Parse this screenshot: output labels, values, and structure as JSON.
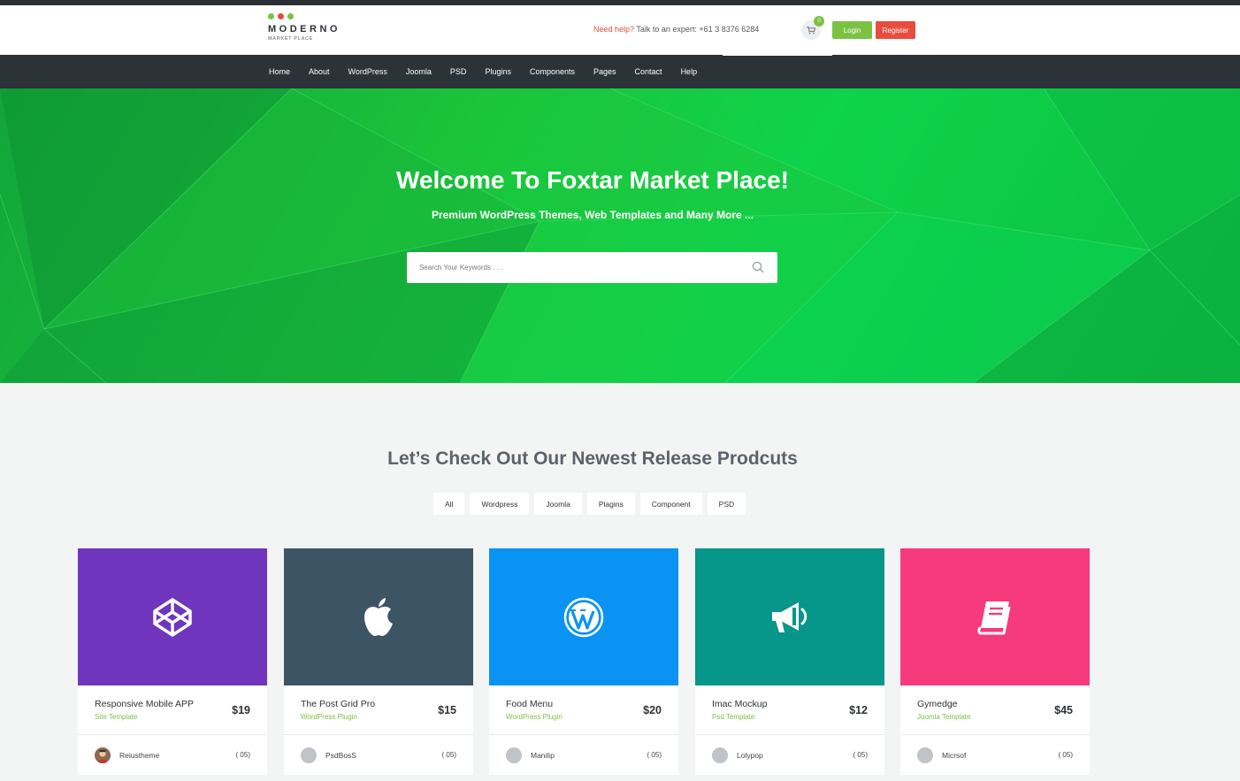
{
  "header": {
    "logo_name": "MODERNO",
    "logo_sub": "MARKET PLACE",
    "logo_dot_colors": [
      "#7cc142",
      "#e74c3c",
      "#7cc142"
    ],
    "help_prefix": "Need help?",
    "help_text": " Talk to an expert: +61 3 8376 6284",
    "cart_icon": "shopping-cart-icon",
    "cart_count": "0",
    "login_label": "Login",
    "register_label": "Register"
  },
  "nav": {
    "items": [
      {
        "label": "Home"
      },
      {
        "label": "About"
      },
      {
        "label": "WordPress"
      },
      {
        "label": "Joomla"
      },
      {
        "label": "PSD"
      },
      {
        "label": "Plugins"
      },
      {
        "label": "Components"
      },
      {
        "label": "Pages"
      },
      {
        "label": "Contact"
      },
      {
        "label": "Help"
      }
    ]
  },
  "hero": {
    "title": "Welcome To Foxtar Market Place!",
    "subtitle": "Premium WordPress Themes, Web Templates and Many More ...",
    "search_placeholder": "Search Your Keywords . . .",
    "search_icon": "search-icon"
  },
  "products": {
    "section_title": "Let’s Check Out Our Newest Release Prodcuts",
    "filters": [
      "All",
      "Wordpress",
      "Joomla",
      "Plagins",
      "Component",
      "PSD"
    ],
    "items": [
      {
        "name": "Responsive Mobile APP",
        "category": "Site Template",
        "price": "$19",
        "author": "Reiustheme",
        "count": "( 05)",
        "icon": "codepen-cube-icon",
        "color": "#6f36bd"
      },
      {
        "name": "The Post Grid Pro",
        "category": "WordPress Plugin",
        "price": "$15",
        "author": "PsdBosS",
        "count": "( 05)",
        "icon": "apple-icon",
        "color": "#3d5464"
      },
      {
        "name": "Food Menu",
        "category": "WordPress Plugin",
        "price": "$20",
        "author": "Manilip",
        "count": "( 05)",
        "icon": "wordpress-icon",
        "color": "#0a93f2"
      },
      {
        "name": "Imac Mockup",
        "category": "Psd Template",
        "price": "$12",
        "author": "Lolypop",
        "count": "( 05)",
        "icon": "megaphone-icon",
        "color": "#06968a"
      },
      {
        "name": "Gymedge",
        "category": "Joomla Template",
        "price": "$45",
        "author": "Micrsof",
        "count": "( 05)",
        "icon": "book-icon",
        "color": "#f73a7c"
      }
    ]
  }
}
